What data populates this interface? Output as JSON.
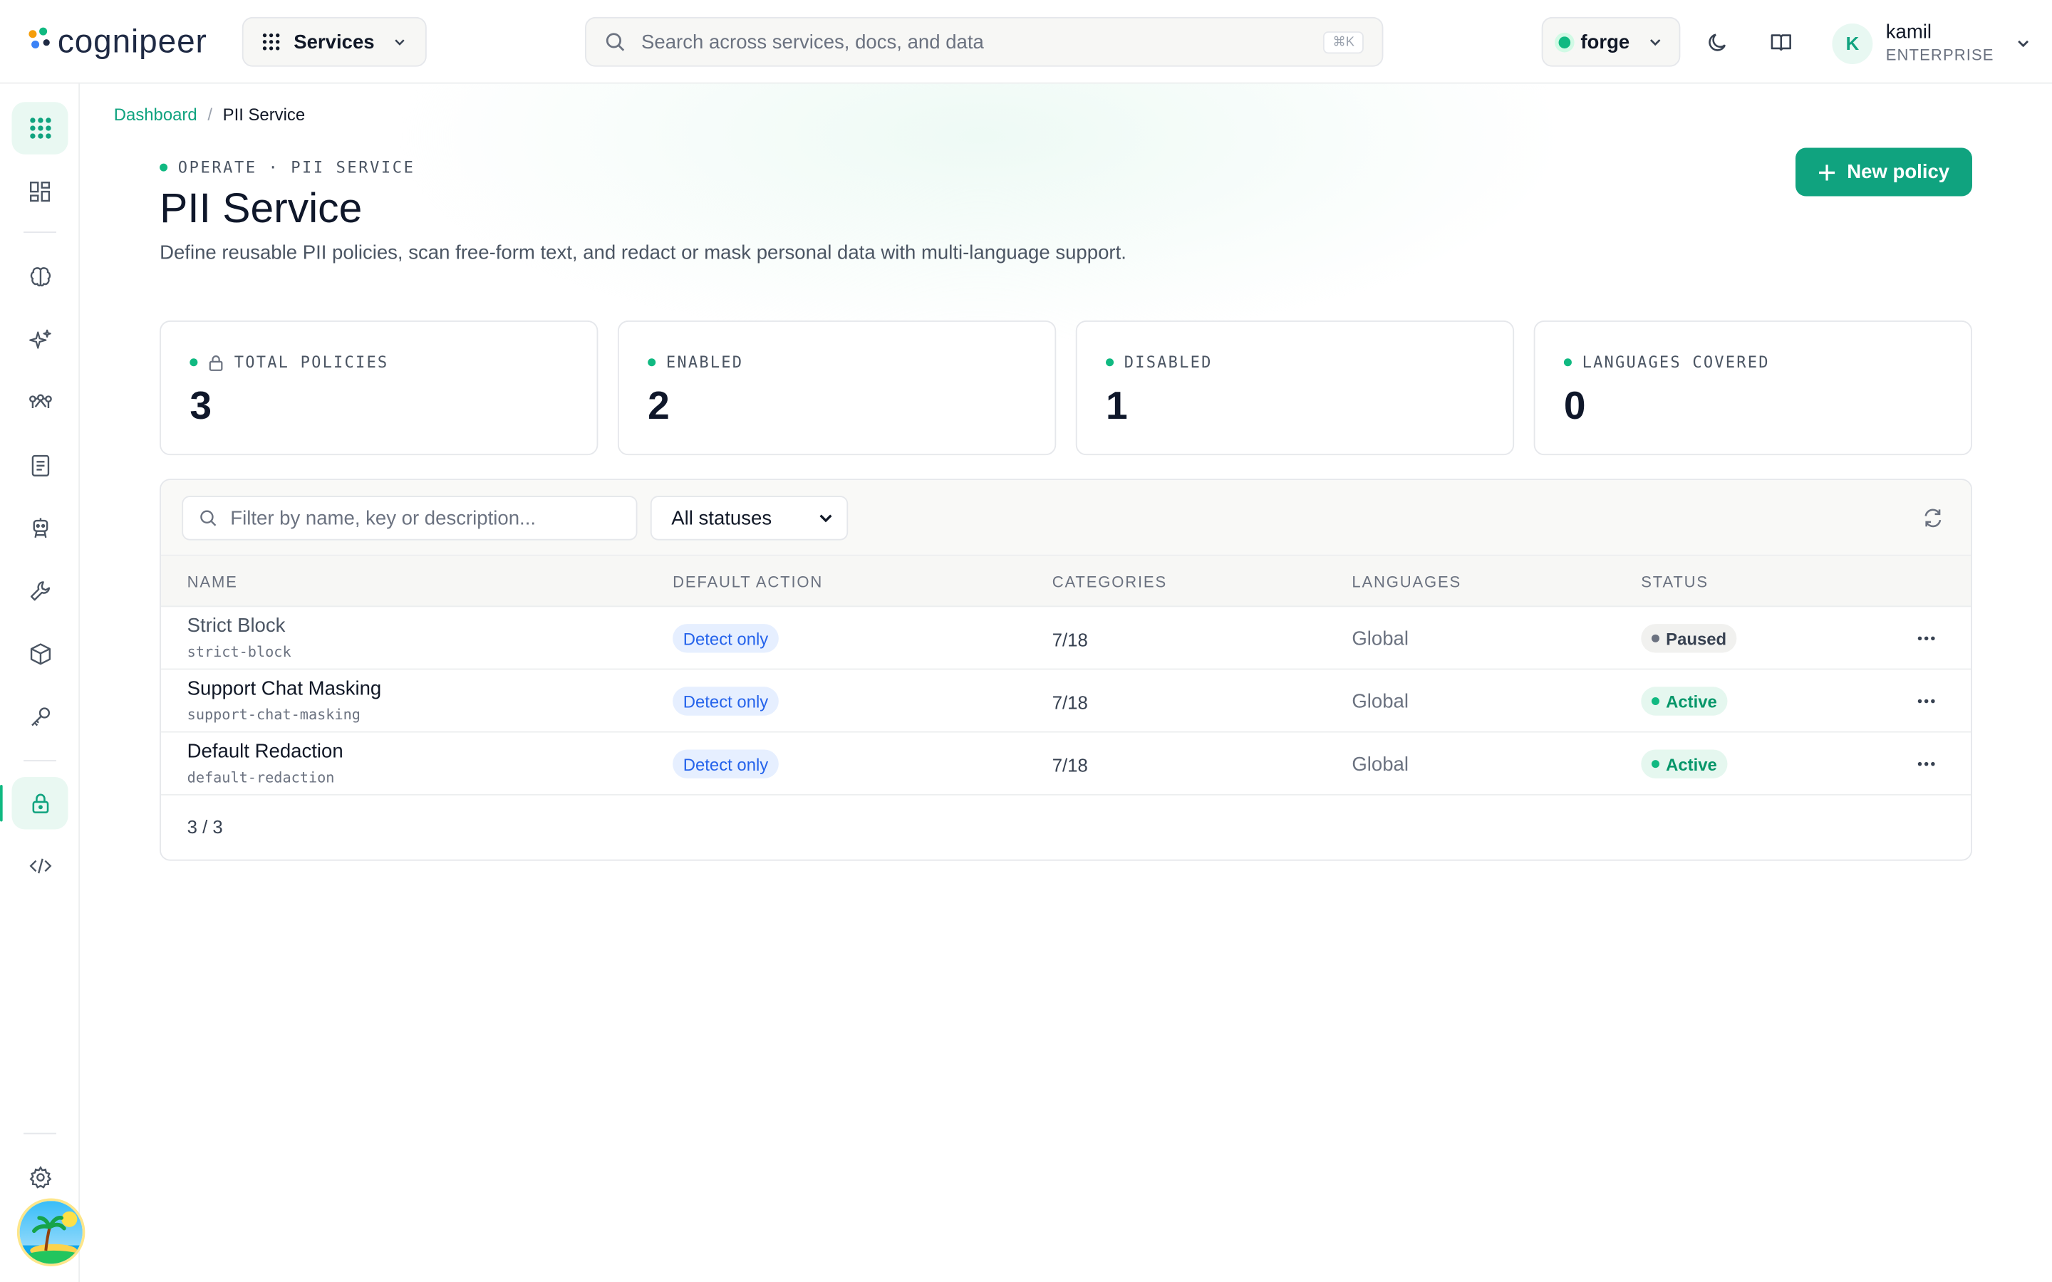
{
  "header": {
    "logo_text": "cognipeer",
    "services_label": "Services",
    "search_placeholder": "Search across services, docs, and data",
    "search_shortcut": "⌘K",
    "environment": "forge",
    "user": {
      "initial": "K",
      "name": "kamil",
      "plan": "ENTERPRISE"
    }
  },
  "breadcrumb": {
    "root": "Dashboard",
    "separator": "/",
    "current": "PII Service"
  },
  "page": {
    "eyebrow": "OPERATE · PII SERVICE",
    "title": "PII Service",
    "description": "Define reusable PII policies, scan free-form text, and redact or mask personal data with multi-language support.",
    "new_button": "New policy"
  },
  "stats": [
    {
      "label": "TOTAL POLICIES",
      "value": "3",
      "icon": "lock-icon"
    },
    {
      "label": "ENABLED",
      "value": "2"
    },
    {
      "label": "DISABLED",
      "value": "1"
    },
    {
      "label": "LANGUAGES COVERED",
      "value": "0"
    }
  ],
  "table": {
    "filter_placeholder": "Filter by name, key or description...",
    "status_filter": "All statuses",
    "columns": [
      "NAME",
      "DEFAULT ACTION",
      "CATEGORIES",
      "LANGUAGES",
      "STATUS"
    ],
    "rows": [
      {
        "name": "Strict Block",
        "key": "strict-block",
        "action": "Detect only",
        "categories": "7/18",
        "languages": "Global",
        "status": "Paused"
      },
      {
        "name": "Support Chat Masking",
        "key": "support-chat-masking",
        "action": "Detect only",
        "categories": "7/18",
        "languages": "Global",
        "status": "Active"
      },
      {
        "name": "Default Redaction",
        "key": "default-redaction",
        "action": "Detect only",
        "categories": "7/18",
        "languages": "Global",
        "status": "Active"
      }
    ],
    "count": "3 / 3"
  },
  "colors": {
    "accent": "#10a37f",
    "active": "#10b981",
    "pill_blue": "#2563eb"
  }
}
